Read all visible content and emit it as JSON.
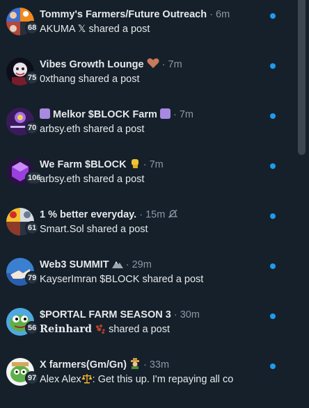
{
  "conversations": [
    {
      "title": "Tommy's Farmers/Future Outreach",
      "time": "6m",
      "preview": "AKUMA 𝕏 shared a post",
      "count": "68",
      "unread": true
    },
    {
      "title": "Vibes Growth Lounge",
      "time": "7m",
      "preview": "0xthang shared a post",
      "count": "75",
      "unread": true,
      "title_emoji": "heart-icon"
    },
    {
      "title": "Melkor $BLOCK Farm",
      "time": "7m",
      "preview": "arbsy.eth shared a post",
      "count": "70",
      "unread": true,
      "title_emoji": "purple-square-icon"
    },
    {
      "title": "We Farm $BLOCK",
      "time": "7m",
      "preview": "arbsy.eth shared a post",
      "count": "106",
      "unread": true,
      "title_emoji": "raised-fist-icon"
    },
    {
      "title": "1 % better everyday.",
      "time": "15m",
      "preview": "Smart.Sol shared a post",
      "count": "61",
      "unread": true,
      "muted": true
    },
    {
      "title": "Web3 SUMMIT",
      "time": "29m",
      "preview": "KayserImran $BLOCK shared a post",
      "count": "79",
      "unread": true,
      "title_emoji": "mountain-icon"
    },
    {
      "title": "$PORTAL FARM SEASON 3",
      "time": "30m",
      "preview_name": "𝐑𝐞𝐢𝐧𝐡𝐚𝐫𝐝",
      "preview_rest": "shared a post",
      "count": "56",
      "unread": true
    },
    {
      "title": "X farmers(Gm/Gn)",
      "time": "33m",
      "preview_name": "Alex Alex",
      "preview_rest": ": Get this up. I'm repaying all co",
      "count": "97",
      "unread": true,
      "title_emoji": "farmer-icon"
    }
  ],
  "separator": "·",
  "colors": {
    "background": "#15202b",
    "unread_dot": "#1d9bf0",
    "text": "#e7e9ea",
    "muted": "#8b98a5"
  }
}
